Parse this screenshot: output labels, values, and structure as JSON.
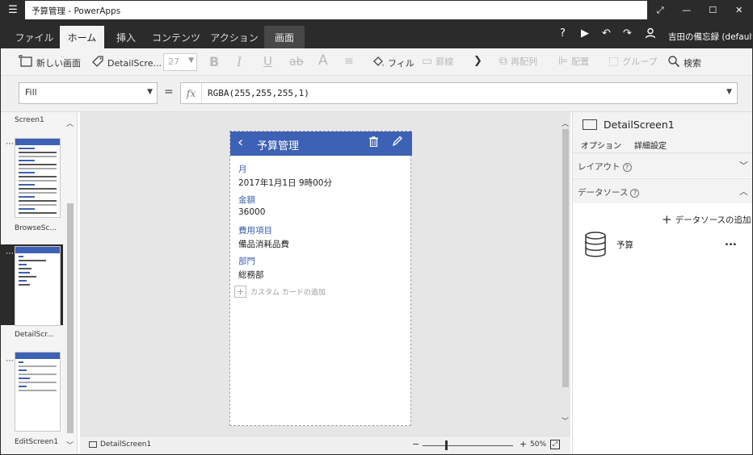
{
  "window": {
    "title": "予算管理 - PowerApps",
    "menu_icon": "☰",
    "controls": [
      "⤢",
      "—",
      "☐",
      "✕"
    ]
  },
  "ribbon": {
    "tabs": [
      {
        "label": "ファイル"
      },
      {
        "label": "ホーム"
      },
      {
        "label": "挿入"
      },
      {
        "label": "コンテンツ"
      },
      {
        "label": "アクション"
      },
      {
        "label": "画面"
      }
    ],
    "active_tab": "ホーム",
    "user": "吉田の備忘録 (default)"
  },
  "toolbar": {
    "new_screen": "新しい画面",
    "screen_name": "DetailScre...",
    "font_size": "27",
    "bold": "B",
    "italic": "I",
    "underline": "U",
    "strikethrough": "ab",
    "font_color": "A",
    "fill": "フィル",
    "border": "罫線",
    "reorder": "再配列",
    "align": "配置",
    "group": "グループ",
    "search": "検索"
  },
  "formula": {
    "property": "Fill",
    "equals": "=",
    "fx": "fx",
    "value": "RGBA(255,255,255,1)"
  },
  "screens": [
    {
      "label": "Screen1"
    },
    {
      "label": "BrowseSc..."
    },
    {
      "label": "DetailScr..."
    },
    {
      "label": "EditScreen1"
    }
  ],
  "app": {
    "title": "予算管理",
    "fields": [
      {
        "label": "月",
        "value": "2017年1月1日 9時00分"
      },
      {
        "label": "金額",
        "value": "36000"
      },
      {
        "label": "費用項目",
        "value": "備品消耗品費"
      },
      {
        "label": "部門",
        "value": "総務部"
      }
    ],
    "add_card": "カスタム カードの追加"
  },
  "status": {
    "screen": "DetailScreen1",
    "zoom": "50%",
    "zoom_value": 50
  },
  "properties": {
    "control_name": "DetailScreen1",
    "tab_options": "オプション",
    "tab_advanced": "詳細設定",
    "layout_section": "レイアウト",
    "datasource_section": "データソース",
    "add_datasource": "データソースの追加",
    "datasource_name": "予算",
    "more": "..."
  },
  "colors": {
    "brand": "#3d61b4",
    "ribbon_bg": "#2b2b2b",
    "tab_underline": "#7a3a8f"
  }
}
